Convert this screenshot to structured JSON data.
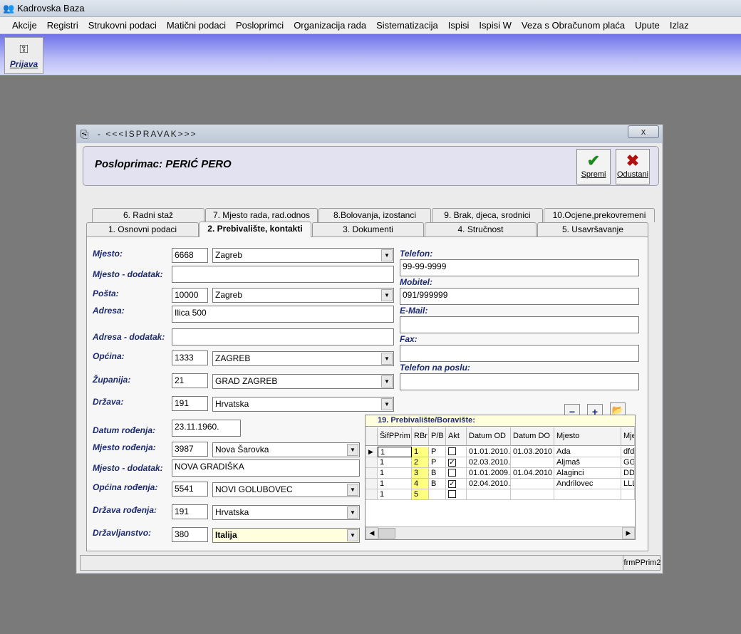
{
  "app": {
    "title": "Kadrovska Baza"
  },
  "menu": [
    "Akcije",
    "Registri",
    "Strukovni podaci",
    "Matični podaci",
    "Posloprimci",
    "Organizacija rada",
    "Sistematizacija",
    "Ispisi",
    "Ispisi W",
    "Veza s Obračunom plaća",
    "Upute",
    "Izlaz"
  ],
  "toolbar": {
    "prijava_label": "Prijava"
  },
  "dialog": {
    "title": "- <<<ISPRAVAK>>>",
    "close_glyph": "x",
    "header": "Posloprimac:  PERIĆ PERO",
    "save_label": "Spremi",
    "cancel_label": "Odustani",
    "tabs_back": [
      "6. Radni staž",
      "7. Mjesto rada, rad.odnos",
      "8.Bolovanja, izostanci",
      "9. Brak, djeca, srodnici",
      "10.Ocjene,prekovremeni"
    ],
    "tabs_front": [
      "1. Osnovni podaci",
      "2. Prebivalište, kontakti",
      "3. Dokumenti",
      "4. Stručnost",
      "5. Usavršavanje"
    ],
    "status_form": "frmPPrim2"
  },
  "form": {
    "mjesto": {
      "label": "Mjesto:",
      "code": "6668",
      "value": "Zagreb"
    },
    "mjesto_dodatak": {
      "label": "Mjesto - dodatak:",
      "value": ""
    },
    "posta": {
      "label": "Pošta:",
      "code": "10000",
      "value": "Zagreb"
    },
    "adresa": {
      "label": "Adresa:",
      "value": "Ilica 500"
    },
    "adresa_dodatak": {
      "label": "Adresa - dodatak:",
      "value": ""
    },
    "opcina": {
      "label": "Općina:",
      "code": "1333",
      "value": "ZAGREB"
    },
    "zupanija": {
      "label": "Županija:",
      "code": "21",
      "value": "GRAD ZAGREB"
    },
    "drzava": {
      "label": "Država:",
      "code": "191",
      "value": "Hrvatska"
    },
    "datum_rodjenja": {
      "label": "Datum rođenja:",
      "value": "23.11.1960."
    },
    "mjesto_rodjenja": {
      "label": "Mjesto rođenja:",
      "code": "3987",
      "value": "Nova Šarovka"
    },
    "mjesto_rodjenja_dodatak": {
      "label": "Mjesto - dodatak:",
      "value": "NOVA GRADIŠKA"
    },
    "opcina_rodjenja": {
      "label": "Općina rođenja:",
      "code": "5541",
      "value": "NOVI GOLUBOVEC"
    },
    "drzava_rodjenja": {
      "label": "Država rođenja:",
      "code": "191",
      "value": "Hrvatska"
    },
    "drzavljanstvo": {
      "label": "Državljanstvo:",
      "code": "380",
      "value": "Italija"
    },
    "telefon": {
      "label": "Telefon:",
      "value": "99-99-9999"
    },
    "mobitel": {
      "label": "Mobitel:",
      "value": "091/999999"
    },
    "email": {
      "label": "E-Mail:",
      "value": ""
    },
    "fax": {
      "label": "Fax:",
      "value": ""
    },
    "telefon_posao": {
      "label": "Telefon na poslu:",
      "value": ""
    }
  },
  "grid": {
    "caption": "19. Prebivalište/Boravište:",
    "buttons": {
      "minus": "−",
      "plus": "+",
      "open_icon": "folder-open-icon"
    },
    "columns": [
      "ŠifPPrim",
      "RBr",
      "P/B",
      "Akt",
      "Datum OD",
      "Datum DO",
      "Mjesto",
      "Mje"
    ],
    "rows": [
      {
        "sif": "1",
        "rbr": "1",
        "pb": "P",
        "akt": false,
        "od": "01.01.2010.",
        "do": "01.03.2010",
        "mjesto": "Ada",
        "mje": "dfd"
      },
      {
        "sif": "1",
        "rbr": "2",
        "pb": "P",
        "akt": true,
        "od": "02.03.2010.",
        "do": "",
        "mjesto": "Aljmaš",
        "mje": "GG"
      },
      {
        "sif": "1",
        "rbr": "3",
        "pb": "B",
        "akt": false,
        "od": "01.01.2009.",
        "do": "01.04.2010",
        "mjesto": "Alaginci",
        "mje": "DD"
      },
      {
        "sif": "1",
        "rbr": "4",
        "pb": "B",
        "akt": true,
        "od": "02.04.2010.",
        "do": "",
        "mjesto": "Andrilovec",
        "mje": "LLL"
      },
      {
        "sif": "1",
        "rbr": "5",
        "pb": "",
        "akt": false,
        "od": "",
        "do": "",
        "mjesto": "",
        "mje": ""
      }
    ]
  },
  "colors": {
    "label": "#1c2a6e",
    "save": "#1a8a1a",
    "cancel": "#b01010",
    "toolbar": "#6f72e8",
    "grid_highlight": "#ffff80"
  }
}
